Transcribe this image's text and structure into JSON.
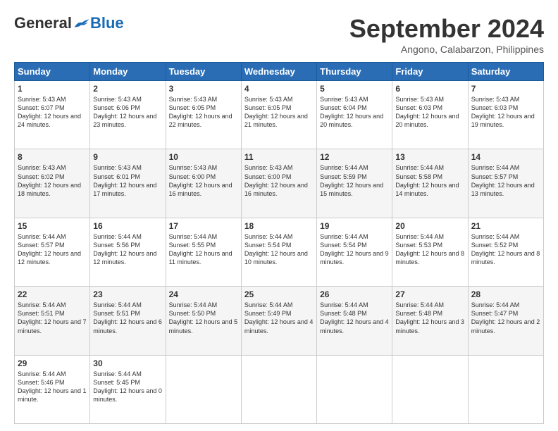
{
  "header": {
    "logo": {
      "general": "General",
      "blue": "Blue"
    },
    "title": "September 2024",
    "location": "Angono, Calabarzon, Philippines"
  },
  "days_of_week": [
    "Sunday",
    "Monday",
    "Tuesday",
    "Wednesday",
    "Thursday",
    "Friday",
    "Saturday"
  ],
  "weeks": [
    [
      {
        "day": "1",
        "sunrise": "5:43 AM",
        "sunset": "6:07 PM",
        "daylight": "12 hours and 24 minutes."
      },
      {
        "day": "2",
        "sunrise": "5:43 AM",
        "sunset": "6:06 PM",
        "daylight": "12 hours and 23 minutes."
      },
      {
        "day": "3",
        "sunrise": "5:43 AM",
        "sunset": "6:05 PM",
        "daylight": "12 hours and 22 minutes."
      },
      {
        "day": "4",
        "sunrise": "5:43 AM",
        "sunset": "6:05 PM",
        "daylight": "12 hours and 21 minutes."
      },
      {
        "day": "5",
        "sunrise": "5:43 AM",
        "sunset": "6:04 PM",
        "daylight": "12 hours and 20 minutes."
      },
      {
        "day": "6",
        "sunrise": "5:43 AM",
        "sunset": "6:03 PM",
        "daylight": "12 hours and 20 minutes."
      },
      {
        "day": "7",
        "sunrise": "5:43 AM",
        "sunset": "6:03 PM",
        "daylight": "12 hours and 19 minutes."
      }
    ],
    [
      {
        "day": "8",
        "sunrise": "5:43 AM",
        "sunset": "6:02 PM",
        "daylight": "12 hours and 18 minutes."
      },
      {
        "day": "9",
        "sunrise": "5:43 AM",
        "sunset": "6:01 PM",
        "daylight": "12 hours and 17 minutes."
      },
      {
        "day": "10",
        "sunrise": "5:43 AM",
        "sunset": "6:00 PM",
        "daylight": "12 hours and 16 minutes."
      },
      {
        "day": "11",
        "sunrise": "5:43 AM",
        "sunset": "6:00 PM",
        "daylight": "12 hours and 16 minutes."
      },
      {
        "day": "12",
        "sunrise": "5:44 AM",
        "sunset": "5:59 PM",
        "daylight": "12 hours and 15 minutes."
      },
      {
        "day": "13",
        "sunrise": "5:44 AM",
        "sunset": "5:58 PM",
        "daylight": "12 hours and 14 minutes."
      },
      {
        "day": "14",
        "sunrise": "5:44 AM",
        "sunset": "5:57 PM",
        "daylight": "12 hours and 13 minutes."
      }
    ],
    [
      {
        "day": "15",
        "sunrise": "5:44 AM",
        "sunset": "5:57 PM",
        "daylight": "12 hours and 12 minutes."
      },
      {
        "day": "16",
        "sunrise": "5:44 AM",
        "sunset": "5:56 PM",
        "daylight": "12 hours and 12 minutes."
      },
      {
        "day": "17",
        "sunrise": "5:44 AM",
        "sunset": "5:55 PM",
        "daylight": "12 hours and 11 minutes."
      },
      {
        "day": "18",
        "sunrise": "5:44 AM",
        "sunset": "5:54 PM",
        "daylight": "12 hours and 10 minutes."
      },
      {
        "day": "19",
        "sunrise": "5:44 AM",
        "sunset": "5:54 PM",
        "daylight": "12 hours and 9 minutes."
      },
      {
        "day": "20",
        "sunrise": "5:44 AM",
        "sunset": "5:53 PM",
        "daylight": "12 hours and 8 minutes."
      },
      {
        "day": "21",
        "sunrise": "5:44 AM",
        "sunset": "5:52 PM",
        "daylight": "12 hours and 8 minutes."
      }
    ],
    [
      {
        "day": "22",
        "sunrise": "5:44 AM",
        "sunset": "5:51 PM",
        "daylight": "12 hours and 7 minutes."
      },
      {
        "day": "23",
        "sunrise": "5:44 AM",
        "sunset": "5:51 PM",
        "daylight": "12 hours and 6 minutes."
      },
      {
        "day": "24",
        "sunrise": "5:44 AM",
        "sunset": "5:50 PM",
        "daylight": "12 hours and 5 minutes."
      },
      {
        "day": "25",
        "sunrise": "5:44 AM",
        "sunset": "5:49 PM",
        "daylight": "12 hours and 4 minutes."
      },
      {
        "day": "26",
        "sunrise": "5:44 AM",
        "sunset": "5:48 PM",
        "daylight": "12 hours and 4 minutes."
      },
      {
        "day": "27",
        "sunrise": "5:44 AM",
        "sunset": "5:48 PM",
        "daylight": "12 hours and 3 minutes."
      },
      {
        "day": "28",
        "sunrise": "5:44 AM",
        "sunset": "5:47 PM",
        "daylight": "12 hours and 2 minutes."
      }
    ],
    [
      {
        "day": "29",
        "sunrise": "5:44 AM",
        "sunset": "5:46 PM",
        "daylight": "12 hours and 1 minute."
      },
      {
        "day": "30",
        "sunrise": "5:44 AM",
        "sunset": "5:45 PM",
        "daylight": "12 hours and 0 minutes."
      },
      null,
      null,
      null,
      null,
      null
    ]
  ],
  "labels": {
    "sunrise": "Sunrise:",
    "sunset": "Sunset:",
    "daylight": "Daylight:"
  }
}
